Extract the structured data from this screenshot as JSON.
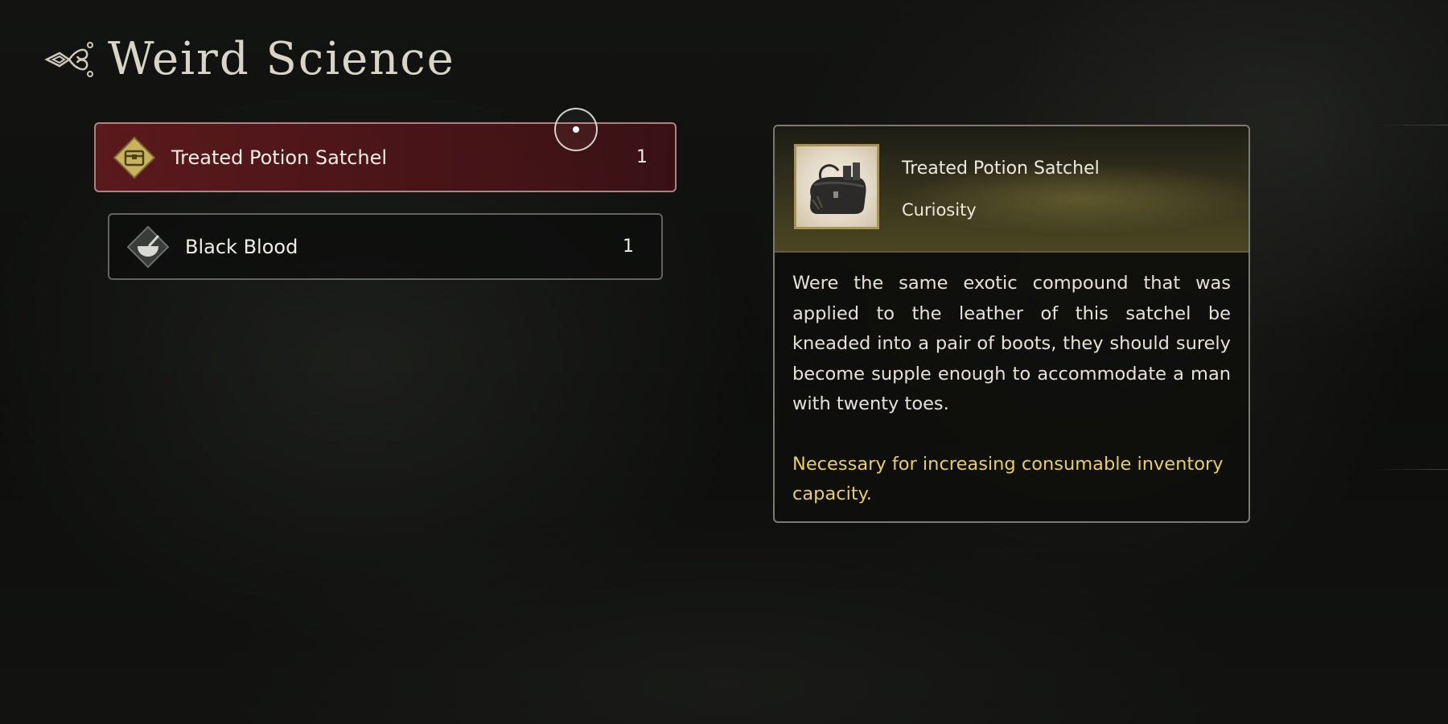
{
  "header": {
    "title": "Weird Science",
    "emblem_icon": "ornament-emblem-icon"
  },
  "items": [
    {
      "name": "Treated Potion Satchel",
      "count": "1",
      "icon": "chest-icon",
      "selected": true
    },
    {
      "name": "Black Blood",
      "count": "1",
      "icon": "bowl-icon",
      "selected": false
    }
  ],
  "detail": {
    "name": "Treated Potion Satchel",
    "category": "Curiosity",
    "thumbnail_icon": "satchel-icon",
    "description": "Were the same exotic compound that was applied to the leather of this satchel be kneaded into a pair of boots, they should surely become supple enough to accommodate a man with twenty toes.",
    "note": "Necessary for increasing consumable inventory capacity."
  },
  "colors": {
    "selected_row": "#5f1a1e",
    "accent_gold": "#a89350",
    "note_text": "#e7cf5c"
  }
}
